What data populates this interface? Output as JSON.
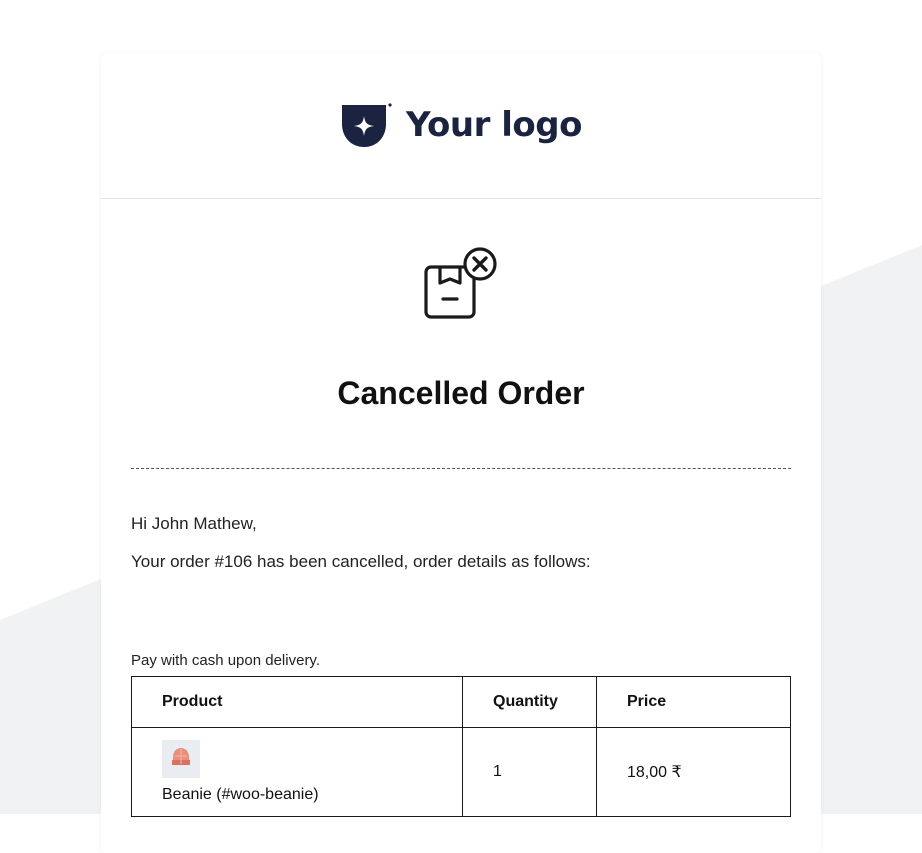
{
  "colors": {
    "brand": "#1a2340",
    "background_shape": "#f1f2f4",
    "card": "#ffffff",
    "beanie": "#e8907c"
  },
  "header": {
    "logo_text": "Your logo",
    "logo_icon": "shield-star-icon"
  },
  "main": {
    "status_icon": "package-cancel-icon",
    "title": "Cancelled Order",
    "greeting": "Hi John Mathew,",
    "message": "Your order #106 has been cancelled, order details as follows:",
    "payment_note": "Pay with cash upon delivery."
  },
  "order_table": {
    "columns": [
      "Product",
      "Quantity",
      "Price"
    ],
    "rows": [
      {
        "image": "beanie-thumbnail",
        "product": "Beanie (#woo-beanie)",
        "quantity": "1",
        "price": "18,00 ₹"
      }
    ]
  }
}
